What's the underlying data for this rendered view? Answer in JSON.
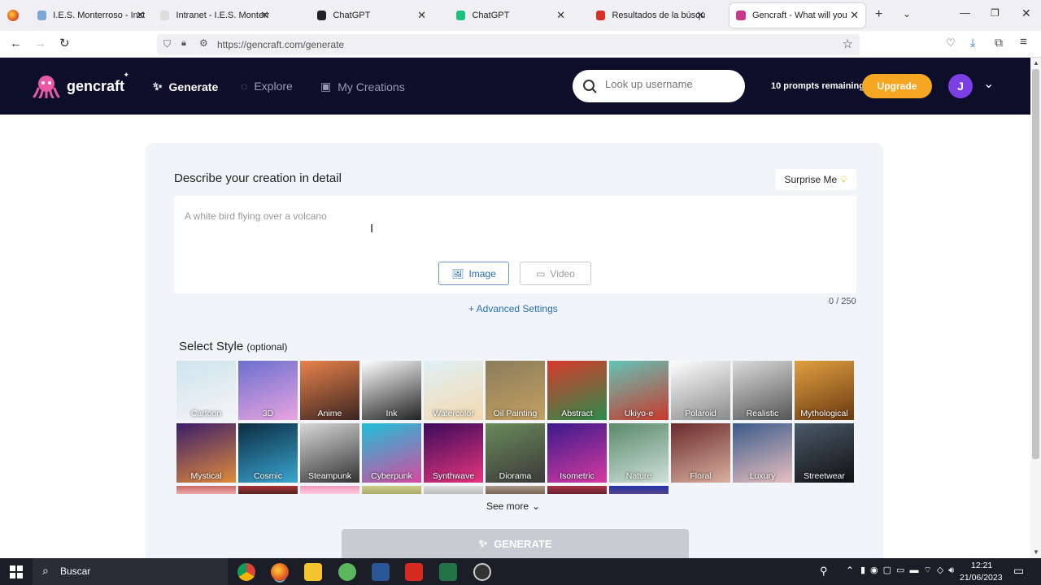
{
  "browser": {
    "tabs": [
      {
        "title": "I.E.S. Monterroso - Instituto",
        "fav": "#7aa7d8",
        "active": false
      },
      {
        "title": "Intranet - I.E.S. Monterroso",
        "fav": "#ddd",
        "active": false
      },
      {
        "title": "ChatGPT",
        "fav": "#222",
        "active": false
      },
      {
        "title": "ChatGPT",
        "fav": "#19c37d",
        "active": false
      },
      {
        "title": "Resultados de la búsqueda",
        "fav": "#d93025",
        "active": false
      },
      {
        "title": "Gencraft - What will you cre",
        "fav": "#c9388c",
        "active": true
      }
    ],
    "url": "https://gencraft.com/generate"
  },
  "header": {
    "logo": "gencraft",
    "nav": [
      {
        "label": "Generate",
        "icon": "sparkle-icon"
      },
      {
        "label": "Explore",
        "icon": "compass-icon"
      },
      {
        "label": "My Creations",
        "icon": "gallery-icon"
      }
    ],
    "search_placeholder": "Look up username",
    "prompts_remaining": "10 prompts remaining",
    "upgrade_label": "Upgrade",
    "avatar_initial": "J"
  },
  "main": {
    "describe_title": "Describe your creation in detail",
    "surprise_label": "Surprise Me",
    "prompt_placeholder": "A white bird flying over a volcano",
    "mode_image": "Image",
    "mode_video": "Video",
    "counter": "0 / 250",
    "advanced": "+ Advanced Settings",
    "style_title": "Select Style",
    "style_optional": "(optional)",
    "see_more": "See more",
    "generate": "GENERATE"
  },
  "styles": [
    {
      "label": "Cartoon",
      "colors": [
        "#cfe4ef",
        "#f4f4f4"
      ]
    },
    {
      "label": "3D",
      "colors": [
        "#6b6fcf",
        "#e9a4e0"
      ]
    },
    {
      "label": "Anime",
      "colors": [
        "#e9824c",
        "#3a2520"
      ]
    },
    {
      "label": "Ink",
      "colors": [
        "#ffffff",
        "#222222"
      ]
    },
    {
      "label": "Watercolor",
      "colors": [
        "#dff1f6",
        "#f4d9b0"
      ]
    },
    {
      "label": "Oil Painting",
      "colors": [
        "#8a7d5c",
        "#c4a060"
      ]
    },
    {
      "label": "Abstract",
      "colors": [
        "#d73a2b",
        "#2b8c4c"
      ]
    },
    {
      "label": "Ukiyo-e",
      "colors": [
        "#63c4b8",
        "#c9382c"
      ]
    },
    {
      "label": "Polaroid",
      "colors": [
        "#ffffff",
        "#8a8a8a"
      ]
    },
    {
      "label": "Realistic",
      "colors": [
        "#dcdcdc",
        "#555555"
      ]
    },
    {
      "label": "Mythological",
      "colors": [
        "#e0a040",
        "#6a3a10"
      ]
    },
    {
      "label": "Mystical",
      "colors": [
        "#3a1e6b",
        "#e08a3a"
      ]
    },
    {
      "label": "Cosmic",
      "colors": [
        "#0b2b3f",
        "#3aa6d1"
      ]
    },
    {
      "label": "Steampunk",
      "colors": [
        "#d8d8d8",
        "#333333"
      ]
    },
    {
      "label": "Cyberpunk",
      "colors": [
        "#1ec0d8",
        "#d64aa0"
      ]
    },
    {
      "label": "Synthwave",
      "colors": [
        "#3a0a5a",
        "#e8357d"
      ]
    },
    {
      "label": "Diorama",
      "colors": [
        "#6a8a5a",
        "#3a3a3a"
      ]
    },
    {
      "label": "Isometric",
      "colors": [
        "#3a1a8a",
        "#d63aa0"
      ]
    },
    {
      "label": "Nature",
      "colors": [
        "#5a8a6a",
        "#cfe0d8"
      ]
    },
    {
      "label": "Floral",
      "colors": [
        "#6a2a2a",
        "#d9b0a0"
      ]
    },
    {
      "label": "Luxury",
      "colors": [
        "#3a5a8a",
        "#e8c0c0"
      ]
    },
    {
      "label": "Streetwear",
      "colors": [
        "#4a5a6a",
        "#111111"
      ]
    }
  ],
  "taskbar": {
    "search": "Buscar",
    "time": "12:21",
    "date": "21/06/2023"
  }
}
